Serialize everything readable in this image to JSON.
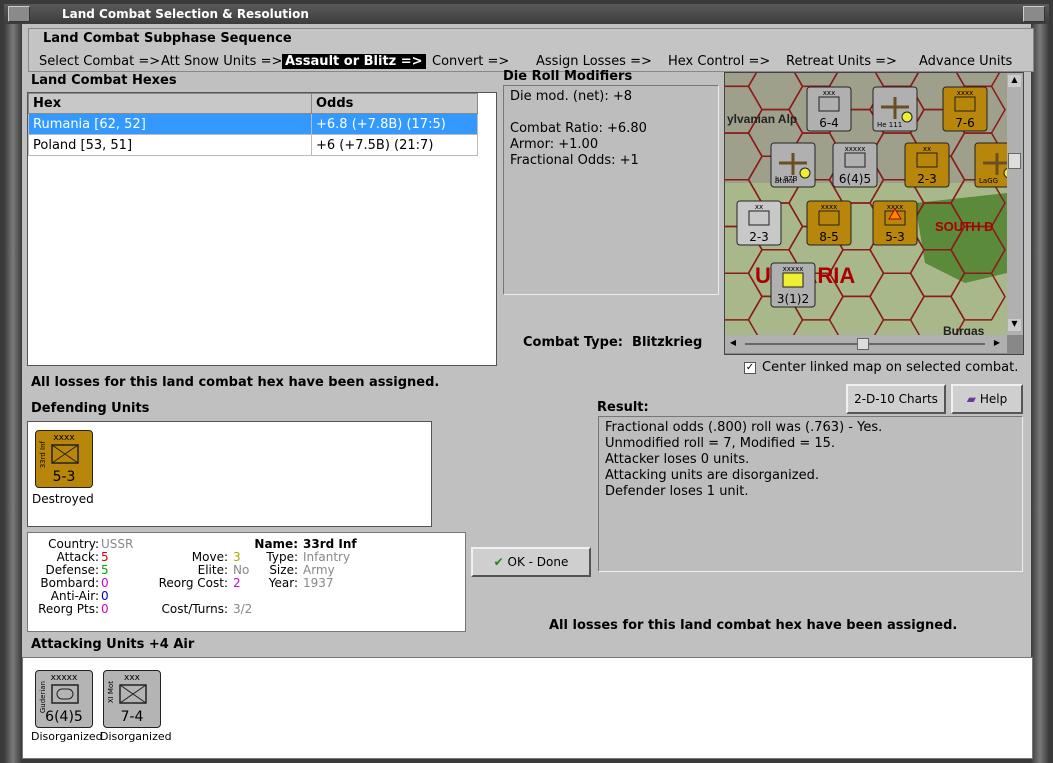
{
  "window": {
    "title": "Land Combat Selection & Resolution"
  },
  "sequence": {
    "title": "Land Combat Subphase Sequence",
    "items": [
      "Select Combat =>",
      "Att Snow Units =>",
      "Assault or Blitz =>",
      "Convert =>",
      "Assign Losses =>",
      "Hex Control =>",
      "Retreat Units =>",
      "Advance Units"
    ],
    "active_index": 2
  },
  "hexes": {
    "title": "Land Combat Hexes",
    "columns": [
      "Hex",
      "Odds"
    ],
    "rows": [
      {
        "hex": "Rumania [62, 52]",
        "odds": "+6.8 (+7.8B) (17:5)",
        "selected": true
      },
      {
        "hex": "Poland [53, 51]",
        "odds": "+6 (+7.5B) (21:7)",
        "selected": false
      }
    ]
  },
  "modifiers": {
    "title": "Die Roll Modifiers",
    "lines": [
      "Die mod. (net): +8",
      "",
      "Combat Ratio: +6.80",
      "Armor: +1.00",
      "Fractional Odds: +1"
    ]
  },
  "combat_type": {
    "label": "Combat Type:",
    "value": "Blitzkrieg"
  },
  "center_map": {
    "label": "Center linked map on selected combat.",
    "checked": true
  },
  "losses_msg": "All losses for this land combat hex have been assigned.",
  "defending": {
    "title": "Defending Units",
    "units": [
      {
        "side": "33rd Inf",
        "size": "xxxx",
        "value": "5-3",
        "caption": "Destroyed",
        "color": "#b8860b"
      }
    ]
  },
  "unit_info": {
    "country_label": "Country:",
    "country": "USSR",
    "attack_label": "Attack:",
    "attack": "5",
    "defense_label": "Defense:",
    "defense": "5",
    "bombard_label": "Bombard:",
    "bombard": "0",
    "antiair_label": "Anti-Air:",
    "antiair": "0",
    "reorg_label": "Reorg Pts:",
    "reorg": "0",
    "move_label": "Move:",
    "move": "3",
    "elite_label": "Elite:",
    "elite": "No",
    "reorgcost_label": "Reorg Cost:",
    "reorgcost": "2",
    "costturns_label": "Cost/Turns:",
    "costturns": "3/2",
    "name_label": "Name:",
    "name": "33rd Inf",
    "type_label": "Type:",
    "type": "Infantry",
    "size_label": "Size:",
    "size": "Army",
    "year_label": "Year:",
    "year": "1937"
  },
  "buttons": {
    "charts": "2-D-10 Charts",
    "help": "Help",
    "ok": "OK - Done"
  },
  "result": {
    "title": "Result:",
    "lines": [
      "Fractional odds (.800) roll was (.763)  - Yes.",
      "Unmodified roll = 7, Modified = 15.",
      "Attacker loses 0 units.",
      "Attacking units are disorganized.",
      "Defender loses 1 unit."
    ]
  },
  "attacking": {
    "title": "Attacking Units +4 Air",
    "units": [
      {
        "side": "Guderian",
        "size": "xxxxx",
        "value": "6(4)5",
        "caption": "Disorganized"
      },
      {
        "side": "XI Mot",
        "size": "xxx",
        "value": "7-4",
        "caption": "Disorganized"
      }
    ]
  },
  "map": {
    "labels": [
      "ylvanian Alp",
      "SOUTH D",
      "ULGARIA",
      "Burgas"
    ],
    "counters": [
      {
        "value": "6-4",
        "size": "xxx"
      },
      {
        "value": "7-6",
        "size": "xxxx"
      },
      {
        "value": "6(4)5",
        "size": "xxxxx"
      },
      {
        "value": "2-3",
        "size": "xx"
      },
      {
        "value": "2-3",
        "size": "xx"
      },
      {
        "value": "8-5",
        "size": "xxxx"
      },
      {
        "value": "5-3",
        "size": "xxxx"
      },
      {
        "value": "3(1)2",
        "size": "xxxxx"
      }
    ],
    "air": [
      "Stuka",
      "Ju 87B",
      "He 111",
      "LaGG"
    ]
  }
}
